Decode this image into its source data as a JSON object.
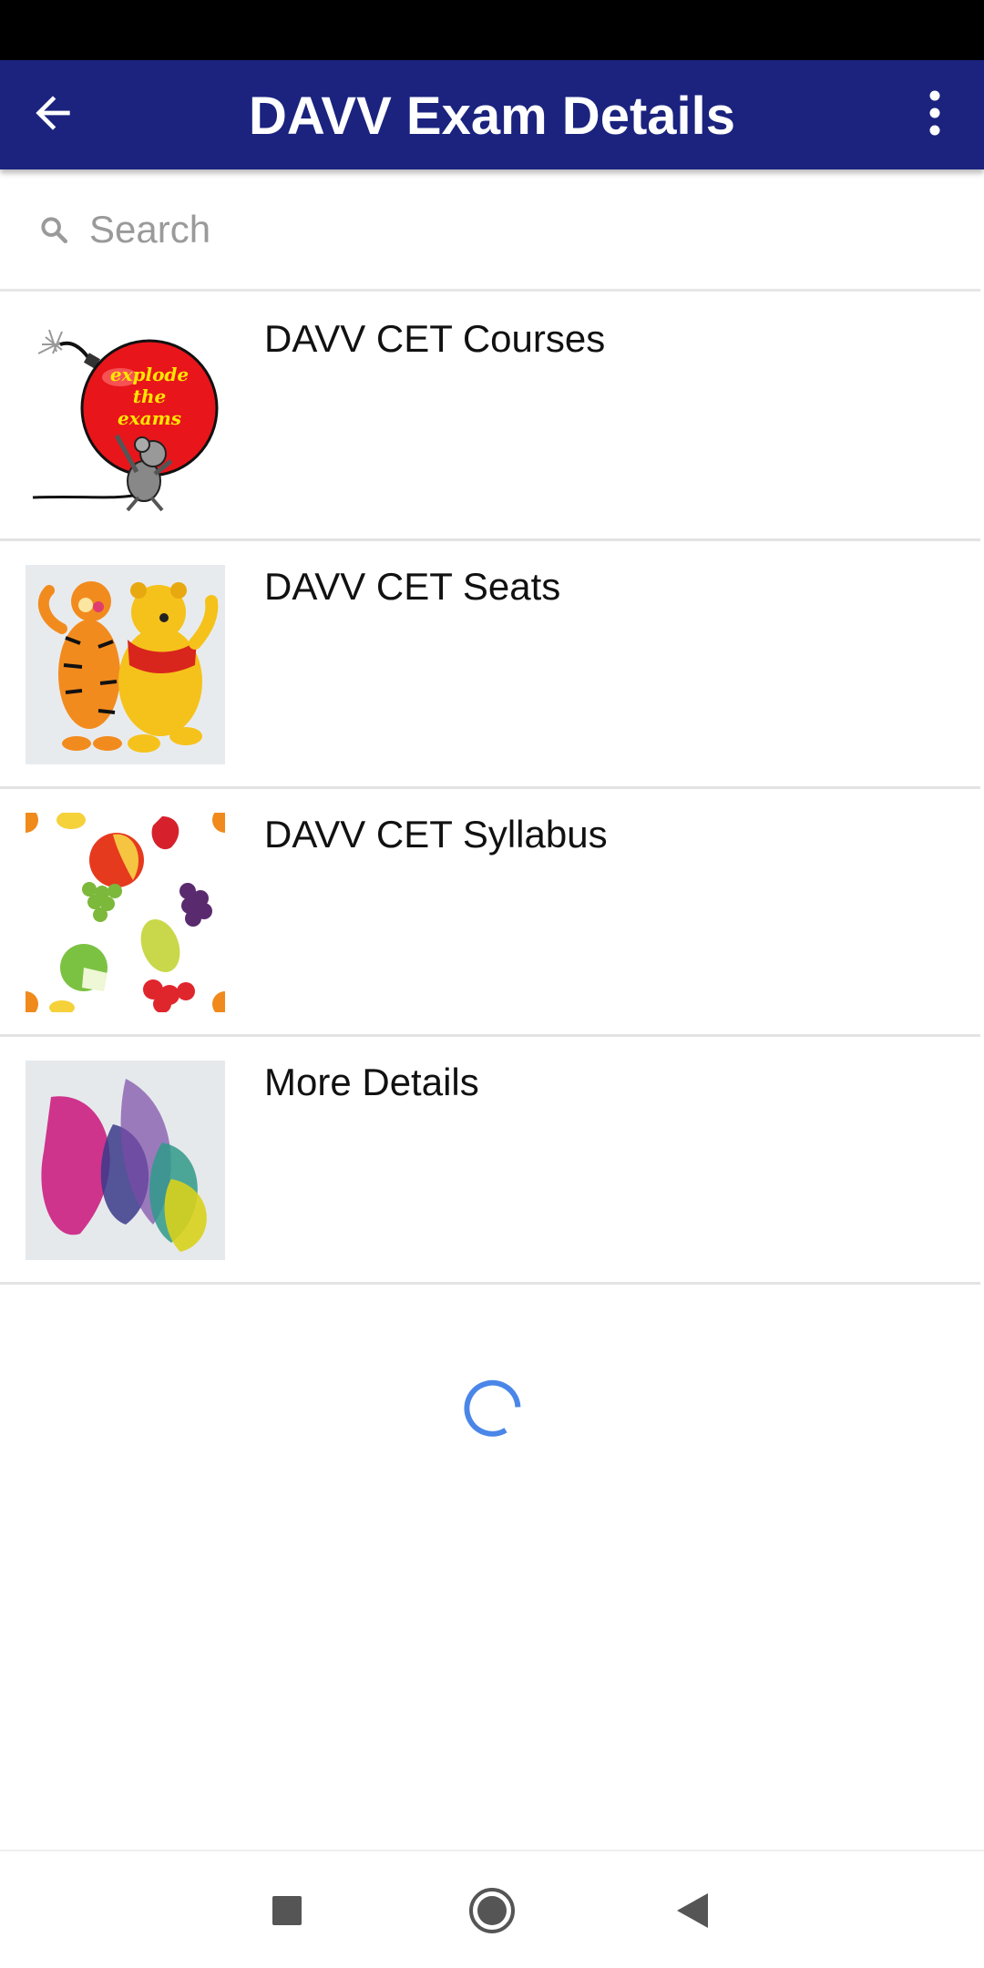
{
  "app_bar": {
    "title": "DAVV Exam Details",
    "background": "#1b237f"
  },
  "search": {
    "placeholder": "Search",
    "value": ""
  },
  "items": [
    {
      "label": "DAVV CET Courses",
      "thumbnail": "explode-the-exams",
      "thumbnail_text": [
        "explode",
        "the",
        "exams"
      ]
    },
    {
      "label": "DAVV CET Seats",
      "thumbnail": "tigger-and-pooh"
    },
    {
      "label": "DAVV CET Syllabus",
      "thumbnail": "fruits"
    },
    {
      "label": "More Details",
      "thumbnail": "petal-logo"
    }
  ],
  "loading": true,
  "icons": {
    "back": "arrow-left-icon",
    "more": "more-vert-icon",
    "search": "search-icon",
    "nav_recents": "square-icon",
    "nav_home": "circle-icon",
    "nav_back": "triangle-back-icon"
  },
  "colors": {
    "accent_spinner": "#4a86e8"
  }
}
